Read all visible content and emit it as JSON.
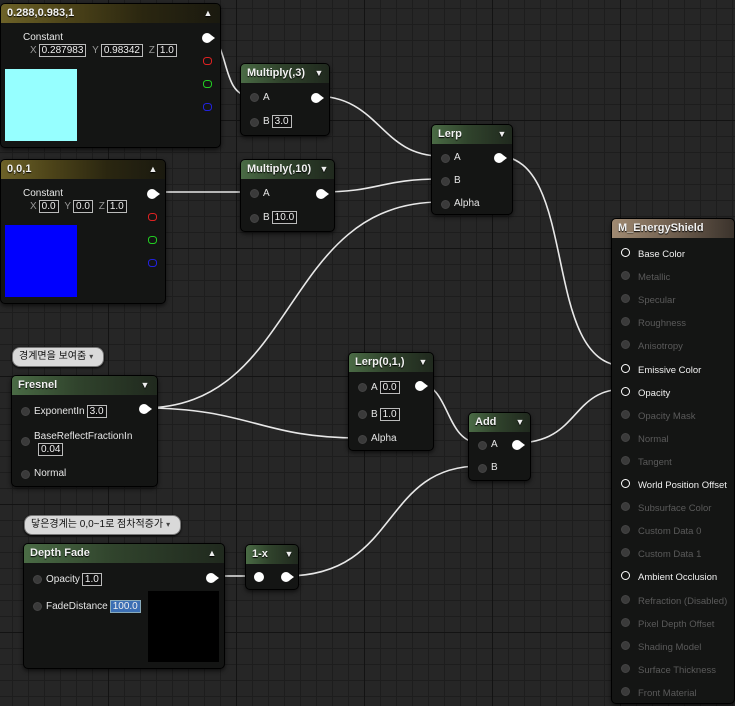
{
  "colors": {
    "wire": "#e8e8e8",
    "swatch_cyan": "#96ffff",
    "swatch_blue": "#0000ff",
    "swatch_black": "#000000",
    "selected_field": "#3c6fb4"
  },
  "nodes": {
    "const_cyan": {
      "title": "0.288,0.983,1",
      "subtitle": "Constant",
      "x_label": "X",
      "x": "0.287983",
      "y_label": "Y",
      "y": "0.98342",
      "z_label": "Z",
      "z": "1.0"
    },
    "const_blue": {
      "title": "0,0,1",
      "subtitle": "Constant",
      "x_label": "X",
      "x": "0.0",
      "y_label": "Y",
      "y": "0.0",
      "z_label": "Z",
      "z": "1.0"
    },
    "multiply3": {
      "title": "Multiply(,3)",
      "a_label": "A",
      "b_label": "B",
      "b_value": "3.0"
    },
    "multiply10": {
      "title": "Multiply(,10)",
      "a_label": "A",
      "b_label": "B",
      "b_value": "10.0"
    },
    "lerp": {
      "title": "Lerp",
      "a_label": "A",
      "b_label": "B",
      "alpha_label": "Alpha"
    },
    "lerp01": {
      "title": "Lerp(0,1,)",
      "a_label": "A",
      "a_value": "0.0",
      "b_label": "B",
      "b_value": "1.0",
      "alpha_label": "Alpha"
    },
    "add": {
      "title": "Add",
      "a_label": "A",
      "b_label": "B"
    },
    "fresnel": {
      "title": "Fresnel",
      "comment": "경계면을 보여줌",
      "exp_label": "ExponentIn",
      "exp_value": "3.0",
      "base_label": "BaseReflectFractionIn",
      "base_value": "0.04",
      "normal_label": "Normal"
    },
    "depthfade": {
      "title": "Depth Fade",
      "comment": "닿은경계는 0,0~1로 점차적증가",
      "opacity_label": "Opacity",
      "opacity_value": "1.0",
      "fade_label": "FadeDistance",
      "fade_value": "100.0"
    },
    "oneminus": {
      "title": "1-x"
    }
  },
  "material": {
    "title": "M_EnergyShield",
    "pins": [
      {
        "label": "Base Color",
        "enabled": true
      },
      {
        "label": "Metallic",
        "enabled": false
      },
      {
        "label": "Specular",
        "enabled": false
      },
      {
        "label": "Roughness",
        "enabled": false
      },
      {
        "label": "Anisotropy",
        "enabled": false
      },
      {
        "label": "Emissive Color",
        "enabled": true
      },
      {
        "label": "Opacity",
        "enabled": true
      },
      {
        "label": "Opacity Mask",
        "enabled": false
      },
      {
        "label": "Normal",
        "enabled": false
      },
      {
        "label": "Tangent",
        "enabled": false
      },
      {
        "label": "World Position Offset",
        "enabled": true
      },
      {
        "label": "Subsurface Color",
        "enabled": false
      },
      {
        "label": "Custom Data 0",
        "enabled": false
      },
      {
        "label": "Custom Data 1",
        "enabled": false
      },
      {
        "label": "Ambient Occlusion",
        "enabled": true
      },
      {
        "label": "Refraction (Disabled)",
        "enabled": false
      },
      {
        "label": "Pixel Depth Offset",
        "enabled": false
      },
      {
        "label": "Shading Model",
        "enabled": false
      },
      {
        "label": "Surface Thickness",
        "enabled": false
      },
      {
        "label": "Front Material",
        "enabled": false
      }
    ]
  }
}
